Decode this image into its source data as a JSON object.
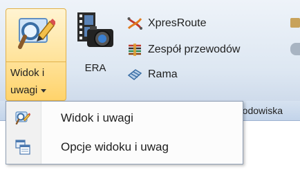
{
  "ribbon": {
    "view_notes_button": {
      "label_line1": "Widok i",
      "label_line2": "uwagi",
      "icon": "magnifier-pencil-icon",
      "state": "hover-open"
    },
    "era_button": {
      "label": "ERA",
      "icon": "film-camera-icon"
    },
    "small_buttons": [
      {
        "label": "XpresRoute",
        "icon": "xpresroute-icon"
      },
      {
        "label": "Zespół przewodów",
        "icon": "wire-harness-icon"
      },
      {
        "label": "Rama",
        "icon": "frame-icon"
      }
    ],
    "group_footer_label": "rodowiska"
  },
  "menu": {
    "items": [
      {
        "label": "Widok i uwagi",
        "icon": "view-notes-icon"
      },
      {
        "label": "Opcje widoku i uwag",
        "icon": "view-options-icon"
      }
    ]
  },
  "colors": {
    "highlight_fill": "#ffe39b",
    "highlight_border": "#e0b04a",
    "ribbon_bg": "#dde7f2"
  }
}
